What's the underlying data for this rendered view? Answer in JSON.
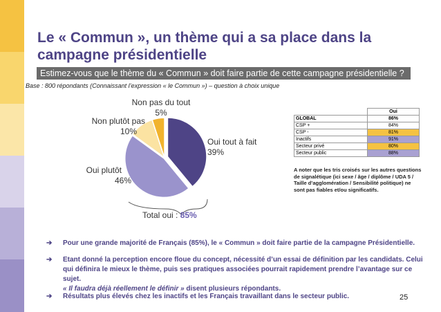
{
  "slide": {
    "title": "Le « Commun », un thème qui a sa place dans la campagne présidentielle",
    "question": "Estimez-vous que le thème du « Commun » doit faire partie de cette campagne présidentielle ?",
    "base": "Base : 800 répondants (Connaissant l’expression « le Commun ») – question à choix unique",
    "page_number": "25"
  },
  "sidebar": {
    "colors": [
      "#f5c242",
      "#f9d66d",
      "#fbe6a8",
      "#d9d3ea",
      "#b8b0d8",
      "#9a90c6"
    ]
  },
  "chart_data": {
    "type": "pie",
    "slices": [
      {
        "label": "Oui tout à fait",
        "value": 39,
        "value_label": "39%",
        "color": "#4e4486"
      },
      {
        "label": "Oui plutôt",
        "value": 46,
        "value_label": "46%",
        "color": "#9a93cc"
      },
      {
        "label": "Non plutôt pas",
        "value": 10,
        "value_label": "10%",
        "color": "#fbe3a2"
      },
      {
        "label": "Non pas du tout",
        "value": 5,
        "value_label": "5%",
        "color": "#f1b32d"
      }
    ],
    "total_label": "Total oui : ",
    "total_value": "85%"
  },
  "crosstab": {
    "header": "Oui",
    "rows": [
      {
        "label": "GLOBAL",
        "value": "86%",
        "bold": true,
        "bg": "#ffffff"
      },
      {
        "label": "CSP +",
        "value": "84%",
        "bold": false,
        "bg": "#ffffff"
      },
      {
        "label": "CSP -",
        "value": "81%",
        "bold": false,
        "bg": "#f5c242"
      },
      {
        "label": "Inactifs",
        "value": "91%",
        "bold": false,
        "bg": "#a9a1d2"
      },
      {
        "label": "Secteur privé",
        "value": "80%",
        "bold": false,
        "bg": "#f5c242"
      },
      {
        "label": "Secteur public",
        "value": "88%",
        "bold": false,
        "bg": "#a9a1d2"
      }
    ],
    "note": "A noter que les tris croisés sur les autres questions de signalétique (ici sexe / âge / diplôme / UDA 5 / Taille d’agglomération / Sensibilité politique) ne sont pas fiables et/ou significatifs."
  },
  "bullets": [
    {
      "text": "Pour une grande majorité de Français (85%), le « Commun » doit faire partie de la campagne Présidentielle."
    },
    {
      "text": "Etant donné la perception encore floue du concept, nécessité d’un essai de définition par les candidats. Celui qui définira le mieux le thème, puis ses pratiques associées pourrait rapidement prendre l’avantage sur ce sujet.",
      "quote": "« Il faudra déjà réellement le définir »",
      "quote_suffix": " disent plusieurs répondants."
    },
    {
      "text": "Résultats plus élevés chez les inactifs et les Français travaillant dans le secteur public."
    }
  ]
}
